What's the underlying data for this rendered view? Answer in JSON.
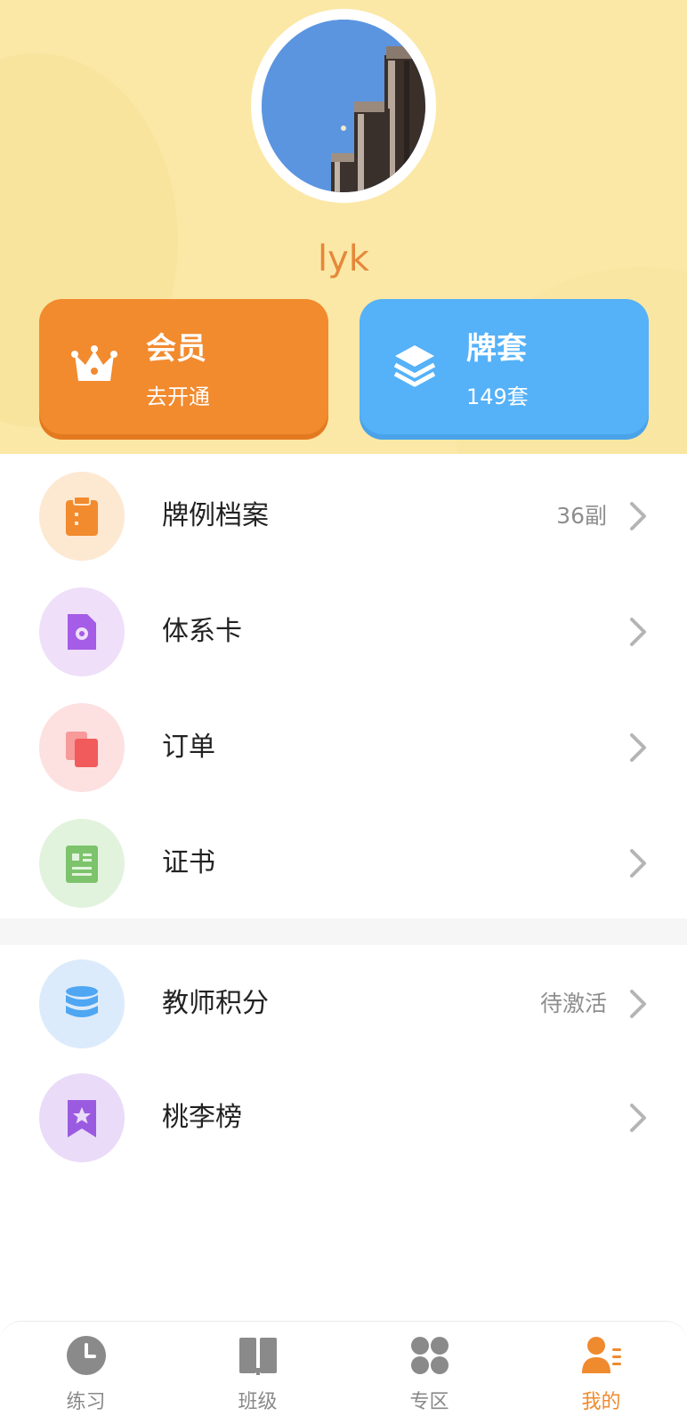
{
  "profile": {
    "username": "lyk"
  },
  "cards": {
    "vip": {
      "title": "会员",
      "subtitle": "去开通",
      "icon": "crown-icon",
      "color": "#f28a2e"
    },
    "decks": {
      "title": "牌套",
      "subtitle": "149套",
      "icon": "layers-icon",
      "color": "#55b1f8"
    }
  },
  "menu": {
    "group1": [
      {
        "label": "牌例档案",
        "value": "36副",
        "icon": "clipboard-icon",
        "bg": "#fde8d2",
        "color": "#f28a2e"
      },
      {
        "label": "体系卡",
        "value": "",
        "icon": "document-gear-icon",
        "bg": "#efdff9",
        "color": "#a55ce6"
      },
      {
        "label": "订单",
        "value": "",
        "icon": "copy-icon",
        "bg": "#fde0e0",
        "color": "#f15b5b"
      },
      {
        "label": "证书",
        "value": "",
        "icon": "certificate-icon",
        "bg": "#e2f3dd",
        "color": "#7cc36c"
      }
    ],
    "group2": [
      {
        "label": "教师积分",
        "value": "待激活",
        "icon": "database-icon",
        "bg": "#dcebfb",
        "color": "#4fa6f2"
      },
      {
        "label": "桃李榜",
        "value": "",
        "icon": "bookmark-star-icon",
        "bg": "#eadcf8",
        "color": "#9b5be0"
      }
    ]
  },
  "tabbar": {
    "tabs": [
      {
        "label": "练习",
        "icon": "clock-icon",
        "active": false
      },
      {
        "label": "班级",
        "icon": "book-icon",
        "active": false
      },
      {
        "label": "专区",
        "icon": "grid-icon",
        "active": false
      },
      {
        "label": "我的",
        "icon": "user-list-icon",
        "active": true
      }
    ],
    "active_color": "#f08a2e",
    "inactive_color": "#8a8a8a"
  }
}
